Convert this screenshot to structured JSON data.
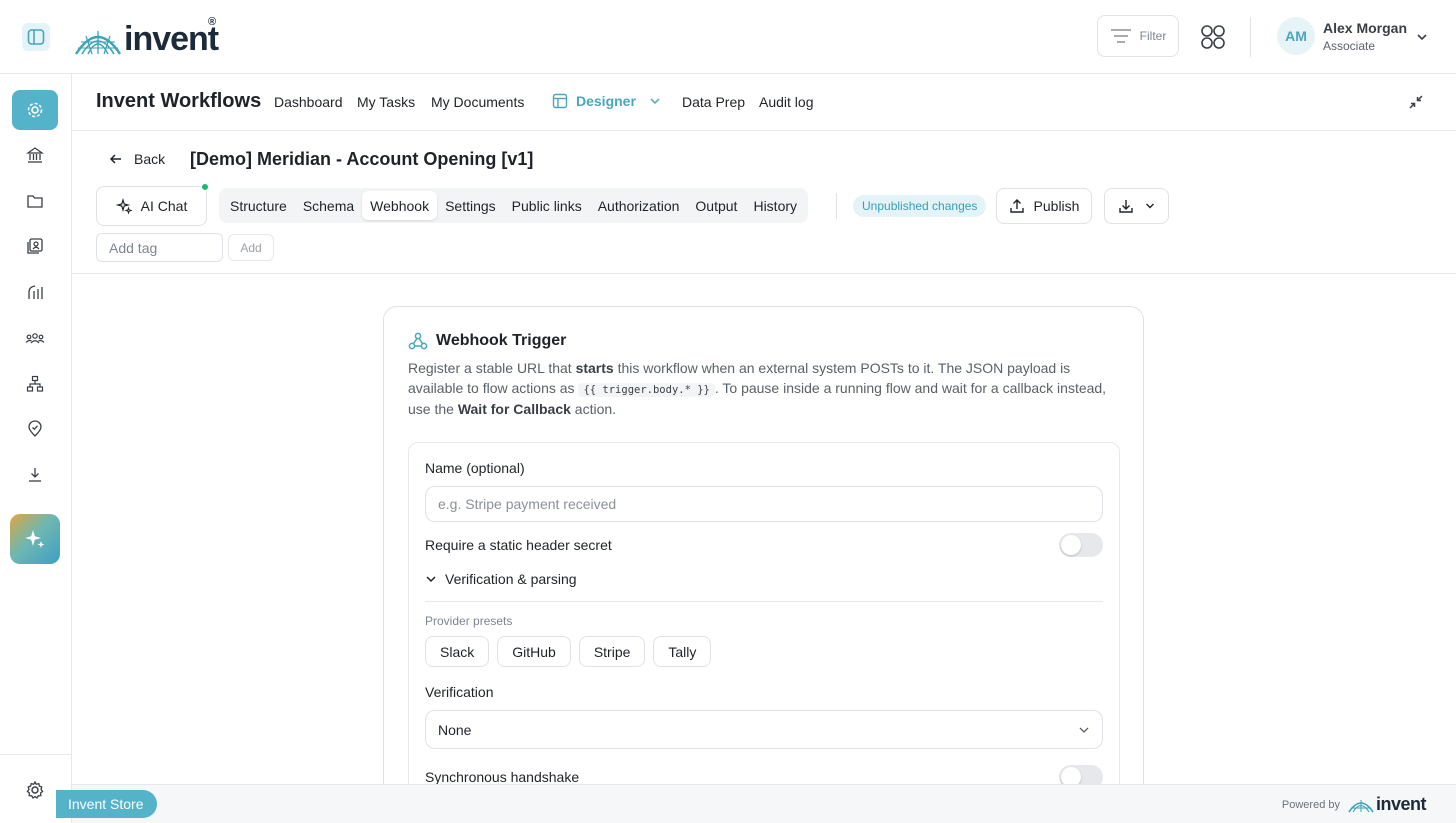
{
  "brand": {
    "name": "invent",
    "reg": "®"
  },
  "header": {
    "filter_label": "Filter",
    "user": {
      "initials": "AM",
      "name": "Alex Morgan",
      "role": "Associate"
    }
  },
  "app": {
    "title": "Invent Workflows",
    "nav": [
      "Dashboard",
      "My Tasks",
      "My Documents",
      "Designer",
      "Data Prep",
      "Audit log"
    ],
    "active_nav": "Designer"
  },
  "workflow": {
    "back_label": "Back",
    "title": "[Demo] Meridian - Account Opening [v1]",
    "ai_chat_label": "AI Chat",
    "tabs": [
      "Structure",
      "Schema",
      "Webhook",
      "Settings",
      "Public links",
      "Authorization",
      "Output",
      "History"
    ],
    "active_tab": "Webhook",
    "status_badge": "Unpublished changes",
    "publish_label": "Publish",
    "tag_placeholder": "Add tag",
    "tag_add_label": "Add"
  },
  "webhook": {
    "title": "Webhook Trigger",
    "desc_1": "Register a stable URL that ",
    "desc_bold_1": "starts",
    "desc_2": " this workflow when an external system POSTs to it. The JSON payload is available to flow actions as ",
    "desc_code": "{{ trigger.body.* }}",
    "desc_3": ". To pause inside a running flow and wait for a callback instead, use the ",
    "desc_bold_2": "Wait for Callback",
    "desc_4": " action.",
    "name_label": "Name (optional)",
    "name_placeholder": "e.g. Stripe payment received",
    "secret_label": "Require a static header secret",
    "secret_enabled": false,
    "section_label": "Verification & parsing",
    "presets_label": "Provider presets",
    "presets": [
      "Slack",
      "GitHub",
      "Stripe",
      "Tally"
    ],
    "verification_label": "Verification",
    "verification_value": "None",
    "handshake_label": "Synchronous handshake",
    "handshake_enabled": false
  },
  "footer": {
    "store_label": "Invent Store",
    "powered_by": "Powered by",
    "powered_logo": "invent"
  },
  "colors": {
    "accent": "#55b3c9",
    "accent_text": "#4aa6bd",
    "success_dot": "#22b573"
  }
}
